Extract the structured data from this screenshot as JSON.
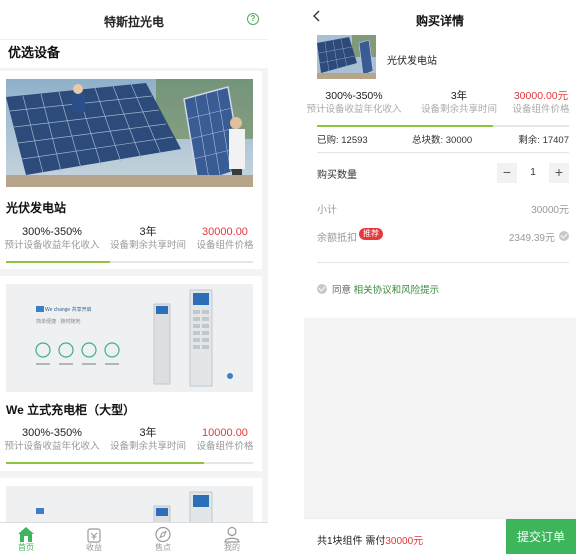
{
  "left": {
    "header_title": "特斯拉光电",
    "section_title": "优选设备",
    "cards": [
      {
        "name": "光伏发电站",
        "stats": [
          {
            "value": "300%-350%",
            "label": "预计设备收益年化收入"
          },
          {
            "value": "3年",
            "label": "设备剩余共享时间"
          },
          {
            "value": "30000.00",
            "label": "设备组件价格"
          }
        ],
        "progress": 0.42
      },
      {
        "name": "We 立式充电柜（大型）",
        "stats": [
          {
            "value": "300%-350%",
            "label": "预计设备收益年化收入"
          },
          {
            "value": "3年",
            "label": "设备剩余共享时间"
          },
          {
            "value": "10000.00",
            "label": "设备组件价格"
          }
        ],
        "progress": 0.8,
        "promo_brand": "We change 共享开启",
        "promo_sub": "简单便捷 · 随时随地"
      }
    ],
    "tabs": [
      {
        "label": "首页",
        "icon": "home-icon",
        "active": true
      },
      {
        "label": "收益",
        "icon": "wallet-icon",
        "active": false
      },
      {
        "label": "售点",
        "icon": "compass-icon",
        "active": false
      },
      {
        "label": "我的",
        "icon": "user-icon",
        "active": false
      }
    ]
  },
  "right": {
    "title": "购买详情",
    "product_name": "光伏发电站",
    "stats": [
      {
        "value": "300%-350%",
        "label": "预计设备收益年化收入"
      },
      {
        "value": "3年",
        "label": "设备剩余共享时间"
      },
      {
        "value": "30000.00元",
        "label": "设备组件价格"
      }
    ],
    "progress": 0.7,
    "sold": "已购: 12593",
    "total": "总块数: 30000",
    "remaining": "剩余: 17407",
    "qty_label": "购买数量",
    "qty_value": "1",
    "minus": "−",
    "plus": "+",
    "subtotal_label": "小计",
    "subtotal_value": "30000元",
    "balance_label": "余额抵扣",
    "balance_badge": "推荐",
    "balance_value": "2349.39元",
    "agree_prefix": "同意",
    "agree_text": "相关协议和风险提示",
    "summary_prefix": "共1块组件 需付",
    "summary_amount": "30000元",
    "submit_label": "提交订单"
  },
  "colors": {
    "accent_green": "#3fb55b",
    "price_red": "#e4393c",
    "progress_green": "#8cc43f"
  }
}
